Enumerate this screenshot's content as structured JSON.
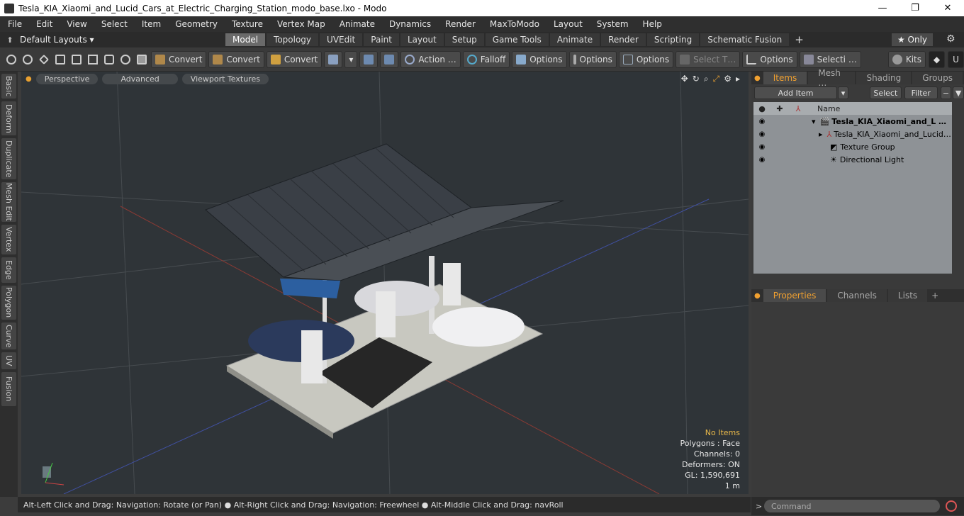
{
  "window": {
    "title": "Tesla_KIA_Xiaomi_and_Lucid_Cars_at_Electric_Charging_Station_modo_base.lxo - Modo",
    "minimize": "—",
    "maximize": "❐",
    "close": "✕"
  },
  "menu": [
    "File",
    "Edit",
    "View",
    "Select",
    "Item",
    "Geometry",
    "Texture",
    "Vertex Map",
    "Animate",
    "Dynamics",
    "Render",
    "MaxToModo",
    "Layout",
    "System",
    "Help"
  ],
  "layouts": {
    "default_label": "Default Layouts ▾",
    "tabs": [
      "Model",
      "Topology",
      "UVEdit",
      "Paint",
      "Layout",
      "Setup",
      "Game Tools",
      "Animate",
      "Render",
      "Scripting",
      "Schematic Fusion"
    ],
    "active_tab": "Model",
    "plus": "+",
    "only_label": "★  Only",
    "gear": "⚙"
  },
  "toolbar": {
    "convert1": "Convert",
    "convert2": "Convert",
    "convert3": "Convert",
    "action": "Action  …",
    "falloff": "Falloff",
    "options1": "Options",
    "options2": "Options",
    "options3": "Options",
    "select_t": "Select T…",
    "options4": "Options",
    "selecti": "Selecti …",
    "kits": "Kits"
  },
  "left_tabs": [
    "Basic",
    "Deform",
    "Duplicate",
    "Mesh Edit",
    "Vertex",
    "Edge",
    "Polygon",
    "Curve",
    "UV",
    "Fusion"
  ],
  "viewport": {
    "perspective": "Perspective",
    "advanced": "Advanced",
    "textures": "Viewport Textures",
    "hud": {
      "no_items": "No Items",
      "polygons": "Polygons : Face",
      "channels": "Channels: 0",
      "deformers": "Deformers: ON",
      "gl": "GL: 1,590,691",
      "scale": "1 m"
    }
  },
  "status": "Alt-Left Click and Drag: Navigation: Rotate (or Pan) ● Alt-Right Click and Drag: Navigation: Freewheel ● Alt-Middle Click and Drag: navRoll",
  "items_panel": {
    "tabs": [
      "Items",
      "Mesh …",
      "Shading",
      "Groups"
    ],
    "add_item": "Add Item",
    "select": "Select",
    "filter": "Filter",
    "name_header": "Name",
    "rows": [
      {
        "label": "Tesla_KIA_Xiaomi_and_L …"
      },
      {
        "label": "Tesla_KIA_Xiaomi_and_Lucid…"
      },
      {
        "label": "Texture Group"
      },
      {
        "label": "Directional Light"
      }
    ]
  },
  "props_panel": {
    "tabs": [
      "Properties",
      "Channels",
      "Lists"
    ],
    "plus": "+"
  },
  "command": {
    "placeholder": "Command"
  }
}
